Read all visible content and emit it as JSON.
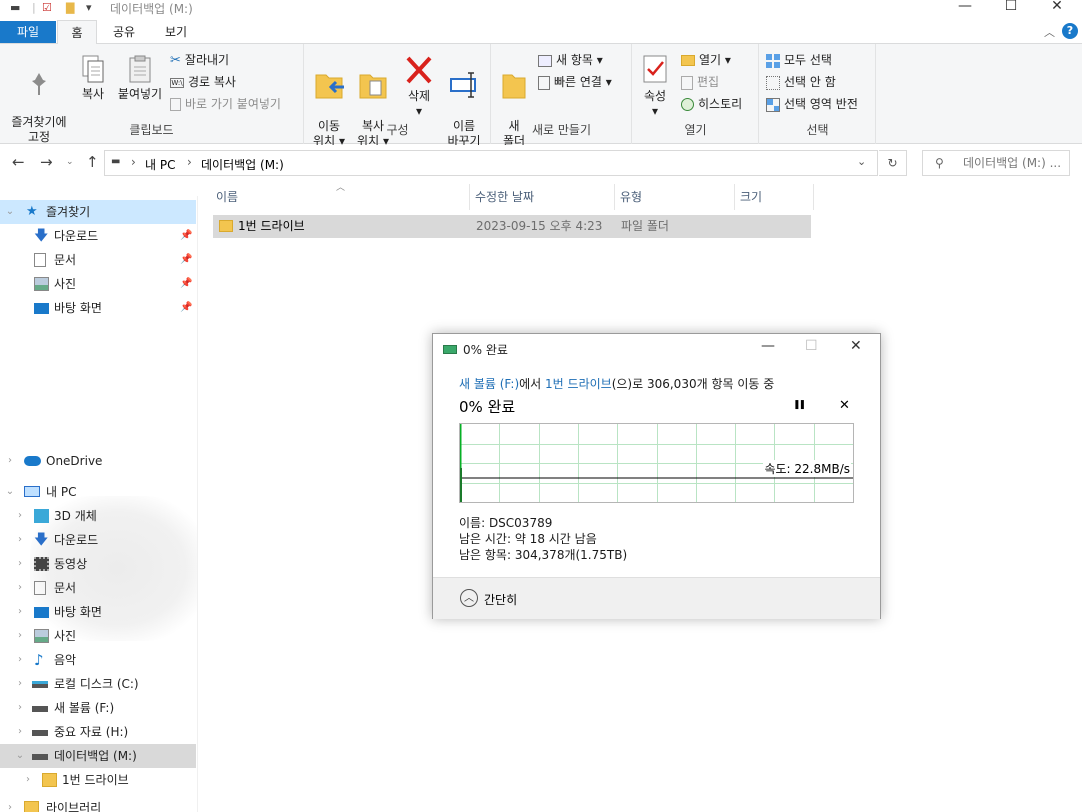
{
  "window": {
    "title": "데이터백업 (M:)",
    "minimize_glyph": "—",
    "maximize_glyph": "☐",
    "close_glyph": "✕"
  },
  "ribbon_tabs": {
    "file": "파일",
    "home": "홈",
    "share": "공유",
    "view": "보기"
  },
  "ribbon": {
    "clipboard": {
      "label": "클립보드",
      "pin": "즐겨찾기에\n고정",
      "copy": "복사",
      "paste": "붙여넣기",
      "cut": "잘라내기",
      "copy_path": "경로 복사",
      "paste_shortcut": "바로 가기 붙여넣기"
    },
    "organize": {
      "label": "구성",
      "move_to": "이동\n위치",
      "copy_to": "복사\n위치",
      "delete": "삭제",
      "rename": "이름\n바꾸기"
    },
    "new": {
      "label": "새로 만들기",
      "new_folder": "새\n폴더",
      "new_item": "새 항목",
      "easy_access": "빠른 연결"
    },
    "open": {
      "label": "열기",
      "properties": "속성",
      "open": "열기",
      "edit": "편집",
      "history": "히스토리"
    },
    "select": {
      "label": "선택",
      "select_all": "모두 선택",
      "select_none": "선택 안 함",
      "invert": "선택 영역 반전"
    }
  },
  "address": {
    "path_root": "내 PC",
    "path_drive": "데이터백업 (M:)",
    "separator": "›",
    "search_placeholder": "데이터백업 (M:) ..."
  },
  "navpane": {
    "quick_access": "즐겨찾기",
    "qa_items": [
      "다운로드",
      "문서",
      "사진",
      "바탕 화면"
    ],
    "onedrive": "OneDrive",
    "this_pc": "내 PC",
    "pc_items": [
      "3D 개체",
      "다운로드",
      "동영상",
      "문서",
      "바탕 화면",
      "사진",
      "음악",
      "로컬 디스크 (C:)",
      "새 볼륨 (F:)",
      "중요 자료 (H:)",
      "데이터백업 (M:)"
    ],
    "sub_folder": "1번 드라이브",
    "library": "라이브러리"
  },
  "columns": {
    "name": "이름",
    "modified": "수정한 날짜",
    "type": "유형",
    "size": "크기"
  },
  "files": [
    {
      "name": "1번 드라이브",
      "modified": "2023-09-15 오후 4:23",
      "type": "파일 폴더",
      "size": ""
    }
  ],
  "dialog": {
    "title": "0% 완료",
    "source": "새 볼륨 (F:)",
    "from_text": "에서 ",
    "dest": "1번 드라이브",
    "to_text": "(으)로 306,030개 항목 이동 중",
    "percent_text": "0% 완료",
    "pause_glyph": "❚❚",
    "cancel_glyph": "✕",
    "speed": "속도: 22.8MB/s",
    "name_line": "이름: DSC03789",
    "time_line": "남은 시간: 약 18 시간 남음",
    "items_line": "남은 항목: 304,378개(1.75TB)",
    "fewer_details": "간단히",
    "progress": 0
  },
  "colors": {
    "accent": "#1979ca",
    "selection": "#cce8ff",
    "grid": "#b9e4c4",
    "progress_green": "#06b025"
  }
}
